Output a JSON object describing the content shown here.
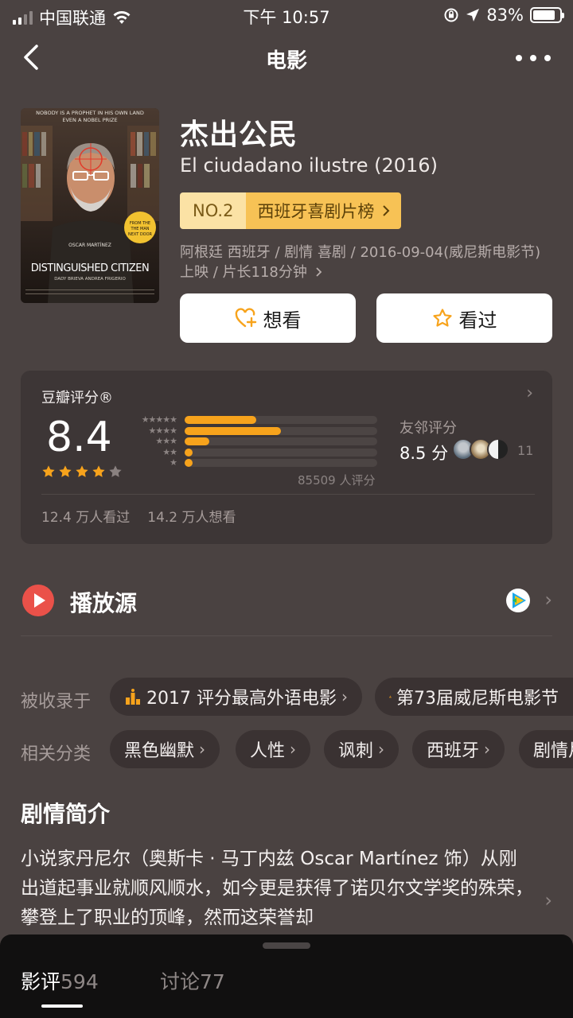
{
  "status_bar": {
    "carrier": "中国联通",
    "time": "下午 10:57",
    "battery": "83%",
    "battery_level": 0.83
  },
  "nav": {
    "title": "电影",
    "back_icon": "chevron-left-icon",
    "more_icon": "more-dots-icon"
  },
  "movie": {
    "title_cn": "杰出公民",
    "title_original": "El ciudadano ilustre (2016)",
    "rank_no": "NO.2",
    "rank_list": "西班牙喜剧片榜",
    "meta": "阿根廷 西班牙 / 剧情 喜剧 / 2016-09-04(威尼斯电影节) 上映 / 片长118分钟",
    "poster": {
      "top_text": "NOBODY IS A PROPHET IN HIS OWN LAND — EVEN A NOBEL PRIZE",
      "actor": "OSCAR MARTÍNEZ",
      "title": "DISTINGUISHED CITIZEN",
      "credits": "DADY BRIEVA · ANDREA FRIGERIO",
      "sticker": "FROM THE DIRECTORS OF THE MAN NEXT DOOR"
    }
  },
  "actions": {
    "want_label": "想看",
    "seen_label": "看过"
  },
  "rating": {
    "title": "豆瓣评分®",
    "score": "8.4",
    "stars": 4,
    "distribution": [
      {
        "stars": 5,
        "pct": 37
      },
      {
        "stars": 4,
        "pct": 50
      },
      {
        "stars": 3,
        "pct": 13
      },
      {
        "stars": 2,
        "pct": 4
      },
      {
        "stars": 1,
        "pct": 4
      }
    ],
    "raters": "85509 人评分",
    "friend_label": "友邻评分",
    "friend_score": "8.5 分",
    "friend_count": "11",
    "seen": "12.4 万人看过",
    "want": "14.2 万人想看"
  },
  "play_source": {
    "label": "播放源",
    "icon": "play-circle-icon",
    "provider_icon": "tencent-video-icon"
  },
  "collections": {
    "label": "被收录于",
    "items": [
      "2017 评分最高外语电影",
      "第73届威尼斯电影节"
    ]
  },
  "categories": {
    "label": "相关分类",
    "items": [
      "黑色幽默",
      "人性",
      "讽刺",
      "西班牙",
      "剧情片"
    ]
  },
  "synopsis": {
    "title": "剧情简介",
    "text": "小说家丹尼尔（奥斯卡 · 马丁内兹 Oscar Martínez 饰）从刚出道起事业就顺风顺水，如今更是获得了诺贝尔文学奖的殊荣，攀登上了职业的顶峰，然而这荣誉却"
  },
  "bottom_tabs": [
    {
      "label": "影评",
      "count": "594"
    },
    {
      "label": "讨论",
      "count": "77"
    }
  ],
  "colors": {
    "background": "#4a4241",
    "card": "#3d3636",
    "accent_orange": "#f7a31c",
    "rank_badge": "#f7c255",
    "play_red": "#ea5149"
  }
}
